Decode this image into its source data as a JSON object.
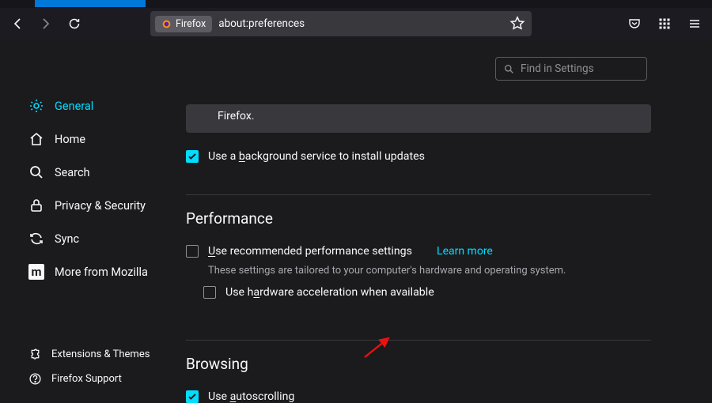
{
  "toolbar": {
    "identity_label": "Firefox",
    "url": "about:preferences"
  },
  "search": {
    "placeholder": "Find in Settings"
  },
  "sidebar": {
    "items": [
      {
        "label": "General"
      },
      {
        "label": "Home"
      },
      {
        "label": "Search"
      },
      {
        "label": "Privacy & Security"
      },
      {
        "label": "Sync"
      },
      {
        "label": "More from Mozilla"
      }
    ],
    "bottom": [
      {
        "label": "Extensions & Themes"
      },
      {
        "label": "Firefox Support"
      }
    ]
  },
  "banner_tail": "Firefox.",
  "bg_service": {
    "pre": "Use a ",
    "u": "b",
    "post": "ackground service to install updates"
  },
  "perf": {
    "title": "Performance",
    "rec_pre_u": "U",
    "rec_post": "se recommended performance settings",
    "learn_more": "Learn more",
    "hint": "These settings are tailored to your computer's hardware and operating system.",
    "hw_pre": "Use h",
    "hw_u": "a",
    "hw_post": "rdware acceleration when available"
  },
  "browsing": {
    "title": "Browsing",
    "auto_pre": "Use ",
    "auto_u": "a",
    "auto_post": "utoscrolling"
  },
  "mozilla_m": "m"
}
